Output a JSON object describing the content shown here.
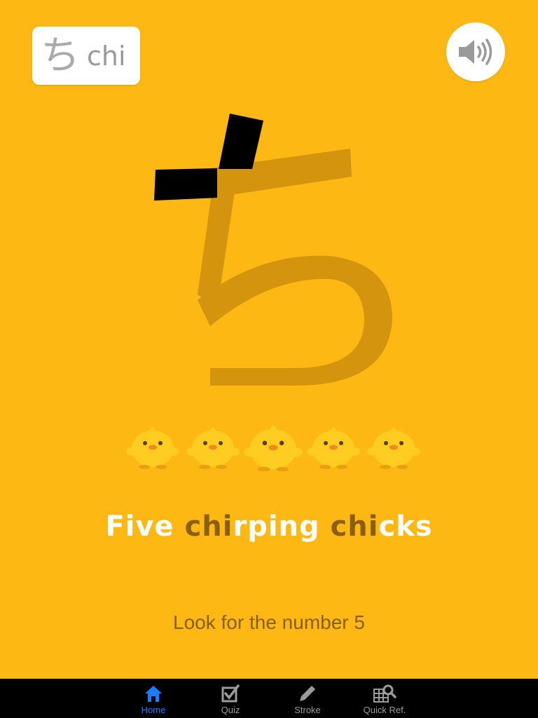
{
  "badge": {
    "kana": "ち",
    "romaji": "chi"
  },
  "sound": {
    "icon": "speaker-icon"
  },
  "mnemonic": {
    "phrase_parts": [
      {
        "text": "Five ",
        "highlight": false
      },
      {
        "text": "chi",
        "highlight": true
      },
      {
        "text": "rping ",
        "highlight": false
      },
      {
        "text": "chi",
        "highlight": true
      },
      {
        "text": "cks",
        "highlight": false
      }
    ],
    "hint": "Look for the number 5",
    "chick_count": 5
  },
  "colors": {
    "background": "#FDB813",
    "stroke_shadow": "#D4940E",
    "stroke_active": "#000000",
    "highlight_text": "#8B5E10",
    "chick": "#FFCC22",
    "tab_active": "#1A7CFF"
  },
  "tabs": [
    {
      "label": "Home",
      "icon": "home-icon",
      "active": true
    },
    {
      "label": "Quiz",
      "icon": "checkbox-icon",
      "active": false
    },
    {
      "label": "Stroke",
      "icon": "pencil-icon",
      "active": false
    },
    {
      "label": "Quick Ref.",
      "icon": "grid-search-icon",
      "active": false
    }
  ]
}
